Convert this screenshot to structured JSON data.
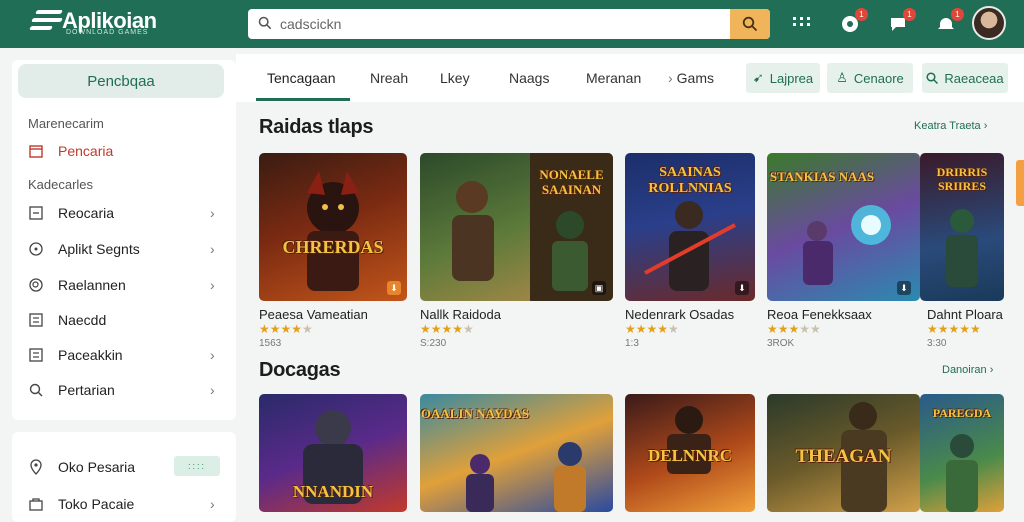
{
  "app": {
    "name": "Aplikoian",
    "tagline": "DOWNLOAD GAMES"
  },
  "search": {
    "value": "cadscickn"
  },
  "topbar": {
    "badges": [
      "1",
      "1",
      "1"
    ]
  },
  "sidebar": {
    "primary_button": "Pencbqaa",
    "section1": "Marenecarim",
    "active_item": "Pencaria",
    "section2": "Kadecarles",
    "items": [
      "Reocaria",
      "Aplikt Segnts",
      "Raelannen",
      "Naecdd",
      "Paceakkin",
      "Pertarian"
    ]
  },
  "sidebar2": {
    "items": [
      "Oko Pesaria",
      "Toko Pacaie"
    ],
    "pill": "::::"
  },
  "tabs": [
    "Tencagaan",
    "Nreah",
    "Lkey",
    "Naags",
    "Meranan",
    "Gams"
  ],
  "actions": [
    {
      "label": "Lajprea",
      "icon": "arrow-icon"
    },
    {
      "label": "Cenaore",
      "icon": "user-icon"
    },
    {
      "label": "Raeaceaa",
      "icon": "search-icon"
    }
  ],
  "section1": {
    "title": "Raidas tlaps",
    "more": "Keatra Traeta",
    "cards": [
      {
        "title": "Peaesa Vameatian",
        "price": "1563",
        "stars": 4,
        "art": "CHRERDAS"
      },
      {
        "title": "Nallk Raidoda",
        "price": "S:230",
        "stars": 4,
        "art": "NONAELE SAAINAN"
      },
      {
        "title": "Nedenrark Osadas",
        "price": "1:3",
        "stars": 4,
        "art": "SAAINAS ROLLNNIAS"
      },
      {
        "title": "Reoa Fenekksaax",
        "price": "3ROK",
        "stars": 3,
        "art": "STANKIAS NAAS"
      },
      {
        "title": "Dahnt Ploara",
        "price": "3:30",
        "stars": 5,
        "art": "DRIRRIS SRIIRES"
      }
    ]
  },
  "section2": {
    "title": "Docagas",
    "more": "Danoiran",
    "cards": [
      {
        "art": "NNANDIN"
      },
      {
        "art": "OAALIN NAYDAS"
      },
      {
        "art": "DELNNRC"
      },
      {
        "art": "THEAGAN"
      },
      {
        "art": "PAREGDA"
      }
    ]
  }
}
